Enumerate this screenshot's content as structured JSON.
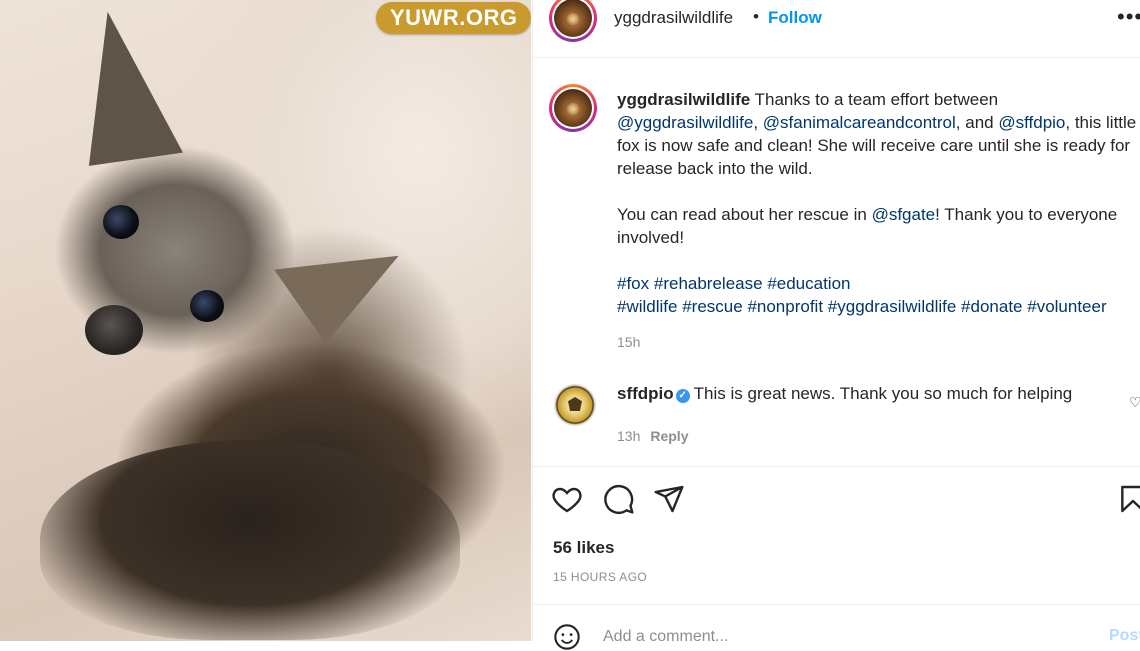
{
  "photo": {
    "alt": "",
    "watermark": "YUWR.ORG"
  },
  "header": {
    "username": "yggdrasilwildlife",
    "separator": "•",
    "follow_label": "Follow",
    "more_icon": "more-horizontal-icon"
  },
  "caption": {
    "username": "yggdrasilwildlife",
    "text_1": " Thanks to a team effort between ",
    "mention_1": "@yggdrasilwildlife",
    "text_2": ", ",
    "mention_2": "@sfanimalcareandcontrol",
    "text_3": ", and ",
    "mention_3": "@sffdpio",
    "text_4": ", this little fox is now safe and clean! She will receive care until she is ready for release back into the wild.",
    "para2_text_1": "You can read about her rescue in ",
    "para2_mention": "@sfgate",
    "para2_text_2": "! Thank you to everyone involved!",
    "hashtags_line1": [
      "#fox",
      "#rehabrelease",
      "#education"
    ],
    "hashtags_line2": [
      "#wildlife",
      "#rescue",
      "#nonprofit",
      "#yggdrasilwildlife",
      "#donate",
      "#volunteer"
    ],
    "time": "15h"
  },
  "comment": {
    "username": "sffdpio",
    "verified_icon": "verified-badge-icon",
    "text": "This is great news. Thank you so much for helping",
    "time": "13h",
    "reply_label": "Reply",
    "like_icon": "heart-small-icon"
  },
  "actions": {
    "like_icon": "heart-icon",
    "comment_icon": "comment-icon",
    "share_icon": "paper-plane-icon",
    "save_icon": "bookmark-icon",
    "likes": "56 likes",
    "timeago": "15 HOURS AGO"
  },
  "add_comment": {
    "emoji_icon": "emoji-icon",
    "placeholder": "Add a comment...",
    "post_label": "Post"
  },
  "colors": {
    "link": "#00376b",
    "follow": "#0095f6",
    "muted": "#8e8e8e",
    "watermark_bg": "#c99a2e"
  }
}
